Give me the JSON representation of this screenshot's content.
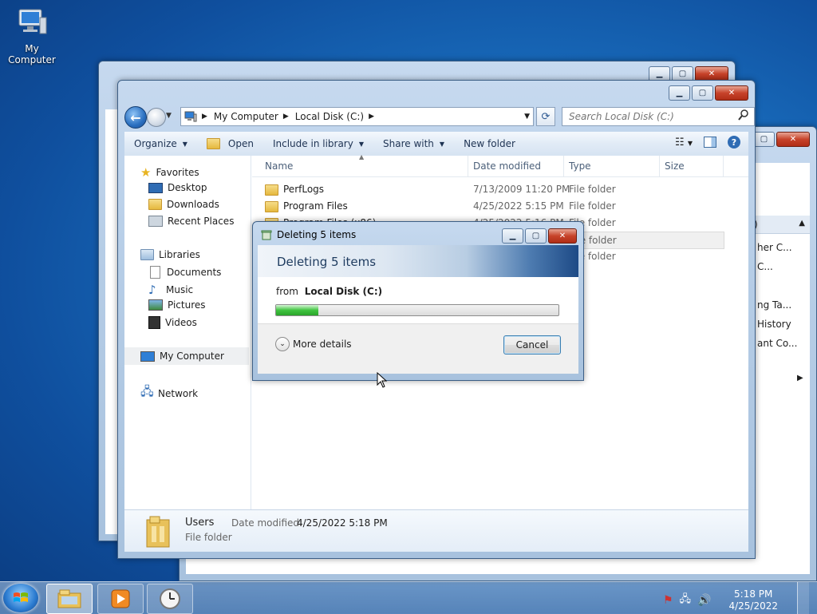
{
  "desktop": {
    "icon_label": "My Computer"
  },
  "explorer": {
    "breadcrumb": [
      "My Computer",
      "Local Disk (C:)"
    ],
    "search_placeholder": "Search Local Disk (C:)",
    "toolbar": {
      "organize": "Organize",
      "open": "Open",
      "include": "Include in library",
      "share": "Share with",
      "new_folder": "New folder"
    },
    "nav": {
      "favorites": "Favorites",
      "desktop": "Desktop",
      "downloads": "Downloads",
      "recent": "Recent Places",
      "libraries": "Libraries",
      "documents": "Documents",
      "music": "Music",
      "pictures": "Pictures",
      "videos": "Videos",
      "computer": "My Computer",
      "network": "Network"
    },
    "columns": {
      "name": "Name",
      "date": "Date modified",
      "type": "Type",
      "size": "Size"
    },
    "rows": [
      {
        "name": "PerfLogs",
        "date": "7/13/2009 11:20 PM",
        "type": "File folder"
      },
      {
        "name": "Program Files",
        "date": "4/25/2022 5:15 PM",
        "type": "File folder"
      },
      {
        "name": "Program Files (x86)",
        "date": "4/25/2022 5:16 PM",
        "type": "File folder"
      },
      {
        "name": "",
        "date": "",
        "type": "File folder"
      },
      {
        "name": "",
        "date": "",
        "type": "File folder"
      }
    ],
    "details": {
      "name": "Users",
      "date_label": "Date modified:",
      "date_value": "4/25/2022 5:18 PM",
      "type": "File folder"
    }
  },
  "right_window": {
    "list": [
      "her C...",
      "C...",
      "ng Ta...",
      "History",
      "ant Co..."
    ]
  },
  "dialog": {
    "title": "Deleting 5 items",
    "banner": "Deleting 5 items",
    "from_label": "from",
    "from_value": "Local Disk (C:)",
    "progress": 0.15,
    "more_details": "More details",
    "cancel": "Cancel"
  },
  "taskbar": {
    "time": "5:18 PM",
    "date": "4/25/2022"
  },
  "colors": {
    "progress": "#41c441",
    "accent": "#1d4a86"
  }
}
